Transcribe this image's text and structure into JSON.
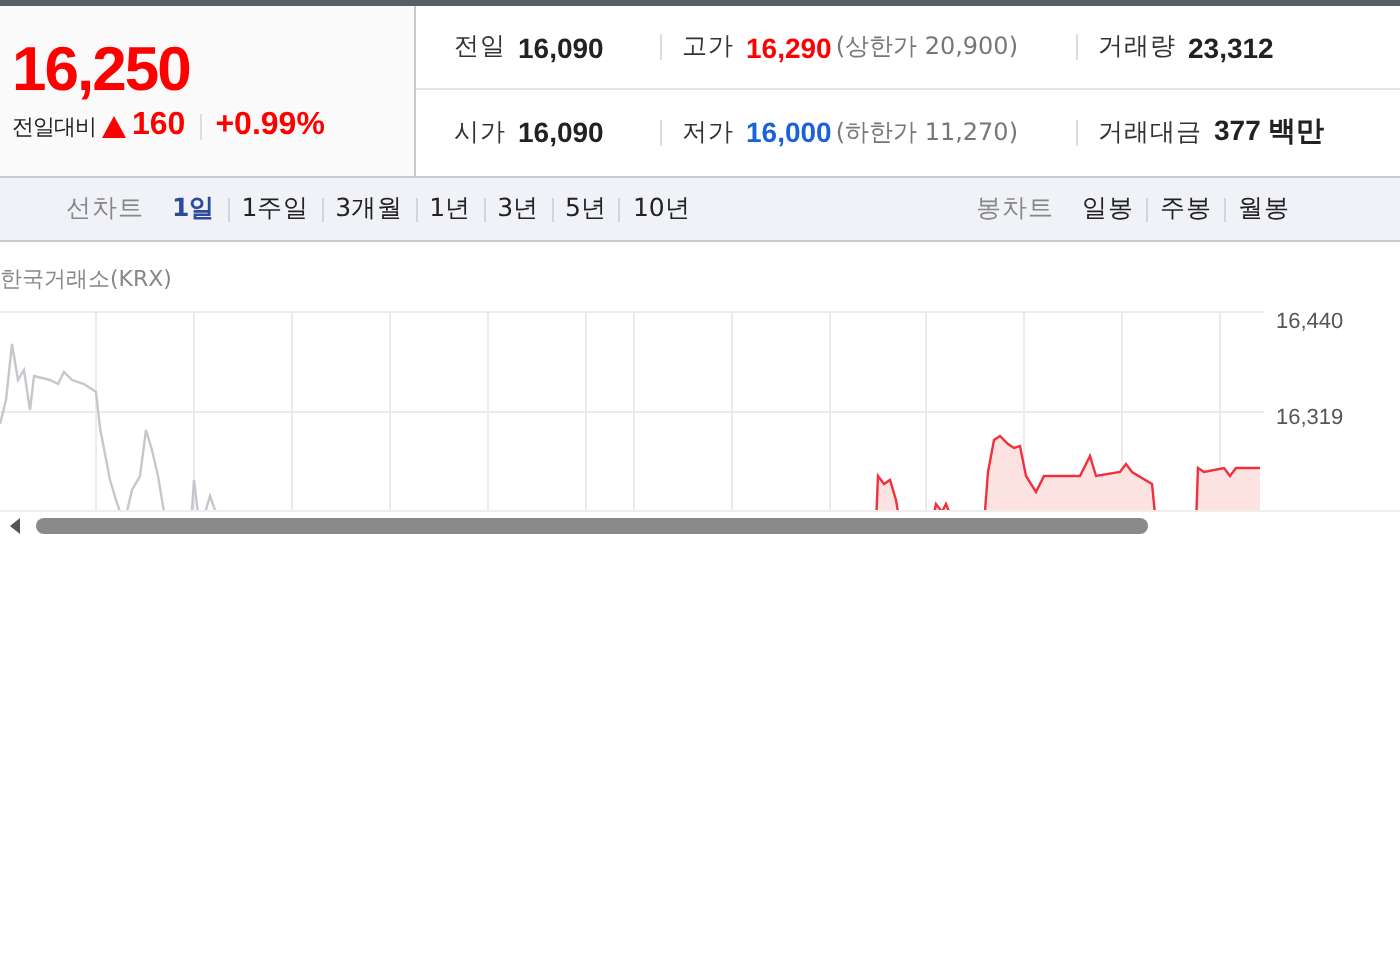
{
  "quote": {
    "price": "16,250",
    "change_label": "전일대비",
    "change": "160",
    "change_percent": "+0.99%"
  },
  "stats": [
    {
      "label": "전일",
      "value": "16,090",
      "kind": "plain"
    },
    {
      "label": "고가",
      "value": "16,290",
      "kind": "up",
      "limit": "(상한가 20,900)"
    },
    {
      "label": "거래량",
      "value": "23,312",
      "kind": "plain"
    },
    {
      "label": "시가",
      "value": "16,090",
      "kind": "plain"
    },
    {
      "label": "저가",
      "value": "16,000",
      "kind": "down",
      "limit": "(하한가 11,270)"
    },
    {
      "label": "거래대금",
      "value": "377 백만",
      "kind": "plain"
    }
  ],
  "line_chart_tabs": {
    "label": "선차트",
    "items": [
      {
        "label": "1일",
        "selected": true
      },
      {
        "label": "1주일",
        "selected": false
      },
      {
        "label": "3개월",
        "selected": false
      },
      {
        "label": "1년",
        "selected": false
      },
      {
        "label": "3년",
        "selected": false
      },
      {
        "label": "5년",
        "selected": false
      },
      {
        "label": "10년",
        "selected": false
      }
    ]
  },
  "candle_chart_tabs": {
    "label": "봉차트",
    "items": [
      {
        "label": "일봉",
        "selected": false
      },
      {
        "label": "주봉",
        "selected": false
      },
      {
        "label": "월봉",
        "selected": false
      }
    ]
  },
  "chart": {
    "source": "한국거래소(KRX)",
    "price_labels": [
      "16,440",
      "16,319"
    ]
  }
}
